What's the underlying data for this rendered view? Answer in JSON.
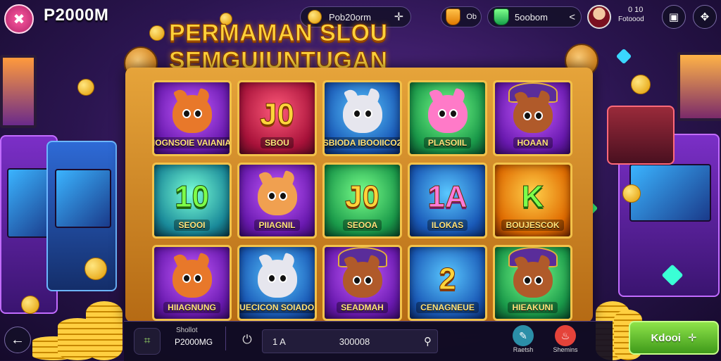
{
  "app": {
    "title": "P2000M",
    "logo_icon": "gamepad-cross-icon"
  },
  "top_bar": {
    "balance_pill": {
      "text": "Pob20orm",
      "icon": "coin-icon",
      "action_icon": "expand-icon"
    },
    "shield_label": "Ob",
    "bonus_pill": {
      "text": "5oobom",
      "icon": "green-shield-icon",
      "action_icon": "share-icon"
    },
    "profile": {
      "line1": "0 10",
      "line2": "Fotoood"
    },
    "menu_icons": [
      "save-icon",
      "settings-icon"
    ]
  },
  "banner": {
    "title": "PERMAMAN SLOU SEMGUIUNTUGAN"
  },
  "reels": [
    {
      "type": "character",
      "character": "fox",
      "caption": "HIOGNSOIE VAIANIAK",
      "bg": "purple"
    },
    {
      "type": "symbol",
      "big": "J0",
      "caption": "SBOU",
      "bg": "red"
    },
    {
      "type": "character",
      "character": "husky",
      "caption": "SBIODA IBOOIICO2",
      "bg": "blue"
    },
    {
      "type": "character",
      "character": "pink-cat",
      "caption": "PLASOIIL",
      "bg": "green"
    },
    {
      "type": "character",
      "character": "wizard-beaver",
      "caption": "HOAAN",
      "bg": "purple"
    },
    {
      "type": "symbol",
      "big": "10",
      "caption": "SEOOI",
      "bg": "teal",
      "green": true
    },
    {
      "type": "character",
      "character": "cat",
      "caption": "PIIAGNIL",
      "bg": "purple"
    },
    {
      "type": "symbol",
      "big": "J0",
      "caption": "SEOOA",
      "bg": "green"
    },
    {
      "type": "symbol",
      "big": "1A",
      "caption": "ILOKAS",
      "bg": "blue",
      "pink": true
    },
    {
      "type": "symbol",
      "big": "K",
      "caption": "BOUJESCOK",
      "bg": "orange",
      "green": true
    },
    {
      "type": "character",
      "character": "fox",
      "caption": "HIIAGNUNG",
      "bg": "purple"
    },
    {
      "type": "character",
      "character": "husky",
      "caption": "SUECICON SOIADOA",
      "bg": "blue"
    },
    {
      "type": "character",
      "character": "wizard-beaver",
      "caption": "SEADMAH",
      "bg": "purple"
    },
    {
      "type": "symbol",
      "big": "2",
      "caption": "CENAGNEUE",
      "bg": "blue"
    },
    {
      "type": "character",
      "character": "wizard-beaver",
      "caption": "HIEAKUNI",
      "bg": "green"
    }
  ],
  "bottom_bar": {
    "wallet": {
      "label": "Shollot",
      "value": "P2000MG"
    },
    "search": {
      "value_left": "1 A",
      "value_right": "300008"
    },
    "actions": [
      {
        "label": "Raetsh",
        "icon": "paint-icon",
        "color": "#2b8fa8"
      },
      {
        "label": "Shemins",
        "icon": "fire-icon",
        "color": "#e5433a"
      }
    ],
    "cta": {
      "label": "Kdooi"
    }
  }
}
